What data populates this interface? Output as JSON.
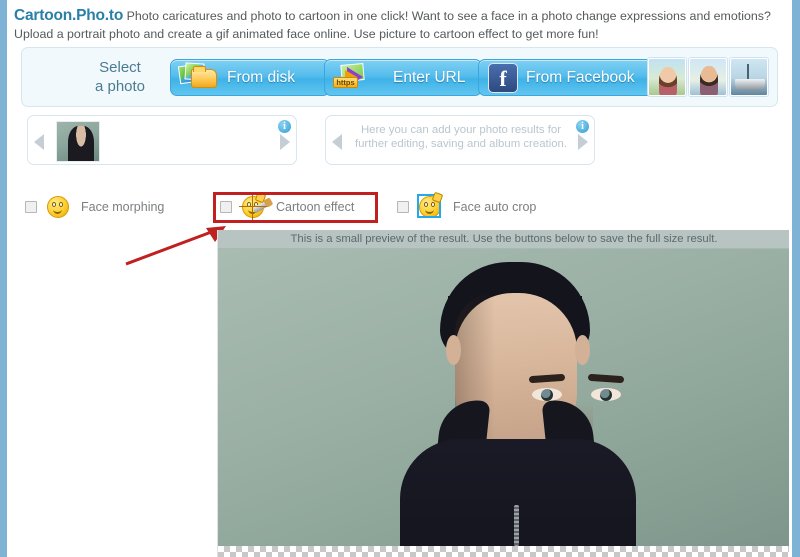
{
  "intro": {
    "brand": "Cartoon.Pho.to",
    "text": " Photo caricatures and photo to cartoon in one click! Want to see a face in a photo change expressions and emotions? Upload a portrait photo and create a gif animated face online. Use picture to cartoon effect to get more fun!"
  },
  "select_panel": {
    "label": "Select\na photo",
    "label_line1": "Select",
    "label_line2": "a photo",
    "buttons": [
      {
        "id": "from-disk",
        "label": "From disk",
        "icon": "folder-photos-icon"
      },
      {
        "id": "enter-url",
        "label": "Enter URL",
        "icon": "http-arrow-icon",
        "tag": "https"
      },
      {
        "id": "from-facebook",
        "label": "From Facebook",
        "icon": "facebook-icon",
        "glyph": "f"
      }
    ],
    "samples": [
      {
        "id": "sample-woman",
        "alt": "woman portrait sample"
      },
      {
        "id": "sample-man",
        "alt": "man portrait sample"
      },
      {
        "id": "sample-boat",
        "alt": "boat photo sample"
      }
    ]
  },
  "strips": {
    "left": {
      "info": "i",
      "thumb_alt": "uploaded portrait thumbnail",
      "arrow_left": "prev",
      "arrow_right": "next"
    },
    "right": {
      "placeholder": "Here you can add your photo results for further editing, saving and album creation.",
      "info": "i",
      "arrow_left": "prev",
      "arrow_right": "next"
    }
  },
  "options": [
    {
      "id": "face-morphing",
      "label": "Face morphing",
      "checked": false,
      "icon": "smiley-surprised-icon"
    },
    {
      "id": "cartoon-effect",
      "label": "Cartoon effect",
      "checked": false,
      "icon": "smiley-brush-icon",
      "highlighted": true
    },
    {
      "id": "face-auto-crop",
      "label": "Face auto crop",
      "checked": false,
      "icon": "smiley-crop-icon"
    }
  ],
  "preview": {
    "bar_text": "This is a small preview of the result. Use the buttons below to save the full size result.",
    "image_alt": "cartoon effect result preview of young man in dark hoodie"
  },
  "annotations": {
    "highlight_color": "#c02020",
    "arrow_color": "#c02020",
    "arrow_target": "cartoon-effect"
  },
  "colors": {
    "brand": "#2a7fa8",
    "button": "#3fb2e8",
    "panel_bg": "#f2f9fc",
    "page_border": "#7fb3d5",
    "highlight": "#c02020"
  }
}
